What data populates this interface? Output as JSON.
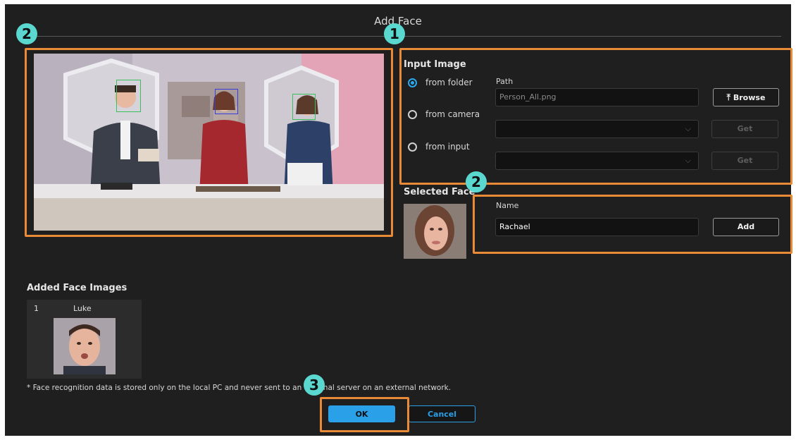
{
  "dialog": {
    "title": "Add Face"
  },
  "callouts": {
    "badge_1": "1",
    "badge_2a": "2",
    "badge_2b": "2",
    "badge_3": "3"
  },
  "input_image": {
    "heading": "Input Image",
    "options": [
      {
        "label": "from folder",
        "selected": true
      },
      {
        "label": "from camera",
        "selected": false
      },
      {
        "label": "from input",
        "selected": false
      }
    ],
    "path_label": "Path",
    "path_value": "Person_All.png",
    "browse_label": "Browse",
    "camera_select_value": "",
    "input_select_value": "",
    "get_label": "Get"
  },
  "selected_face": {
    "heading": "Selected Face",
    "name_label": "Name",
    "name_value": "Rachael",
    "add_label": "Add"
  },
  "added_faces": {
    "heading": "Added Face Images",
    "items": [
      {
        "index": "1",
        "name": "Luke"
      }
    ]
  },
  "note": "* Face recognition data is stored only on the local PC and never sent to an external server on an external network.",
  "footer": {
    "ok_label": "OK",
    "cancel_label": "Cancel"
  },
  "colors": {
    "accent": "#2aa0e8",
    "callout": "#e98a36",
    "badge": "#5ad8d0",
    "face_box_green": "#3bbf5a",
    "face_box_blue": "#3a3adf"
  }
}
